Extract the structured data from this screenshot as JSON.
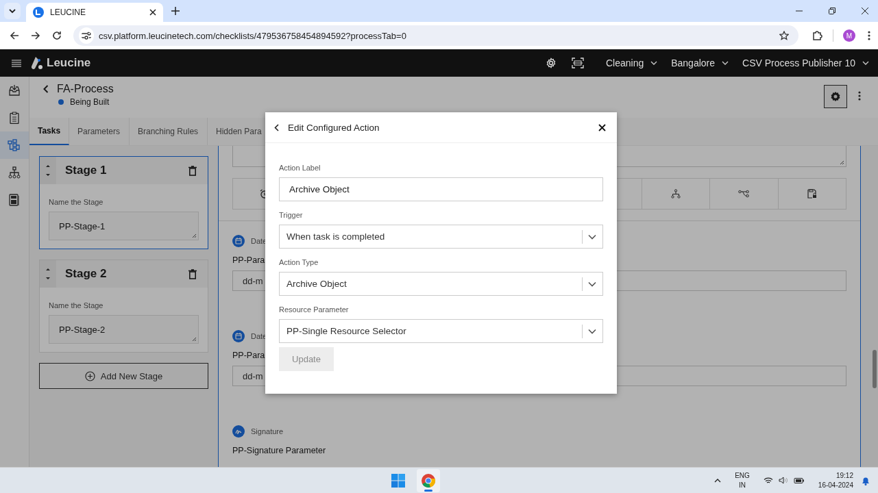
{
  "browser": {
    "tab_title": "LEUCINE",
    "url": "csv.platform.leucinetech.com/checklists/479536758454894592?processTab=0",
    "profile_initial": "M"
  },
  "app": {
    "brand": "Leucine",
    "header_menus": [
      "Cleaning",
      "Bangalore",
      "CSV Process Publisher 10"
    ],
    "nav_items": [
      {
        "selected": false
      },
      {
        "selected": false
      },
      {
        "selected": true
      },
      {
        "selected": false
      },
      {
        "selected": false
      }
    ],
    "process": {
      "title": "FA-Process",
      "status": "Being Built"
    },
    "tabs": [
      {
        "label": "Tasks",
        "selected": true
      },
      {
        "label": "Parameters",
        "selected": false
      },
      {
        "label": "Branching Rules",
        "selected": false
      },
      {
        "label": "Hidden Para",
        "selected": false
      }
    ],
    "stages": [
      {
        "title": "Stage 1",
        "field_label": "Name the Stage",
        "value": "PP-Stage-1",
        "selected": true
      },
      {
        "title": "Stage 2",
        "field_label": "Name the Stage",
        "value": "PP-Stage-2",
        "selected": false
      }
    ],
    "add_stage": "Add New Stage",
    "parameters": [
      {
        "kind": "date",
        "type_label": "Date",
        "name": "PP-Para",
        "placeholder": "dd-m"
      },
      {
        "kind": "date",
        "type_label": "Date",
        "name": "PP-Para",
        "placeholder": "dd-m"
      },
      {
        "kind": "signature",
        "type_label": "Signature",
        "name": "PP-Signature Parameter"
      }
    ]
  },
  "modal": {
    "title": "Edit Configured Action",
    "fields": [
      {
        "kind": "text",
        "label": "Action Label",
        "value": "Archive Object"
      },
      {
        "kind": "select",
        "label": "Trigger",
        "value": "When task is completed"
      },
      {
        "kind": "select",
        "label": "Action Type",
        "value": "Archive Object"
      },
      {
        "kind": "select",
        "label": "Resource Parameter",
        "value": "PP-Single Resource Selector"
      }
    ],
    "button": {
      "label": "Update",
      "disabled": true
    }
  },
  "taskbar": {
    "language": "ENG",
    "region": "IN",
    "time": "19:12",
    "date": "16-04-2024"
  }
}
